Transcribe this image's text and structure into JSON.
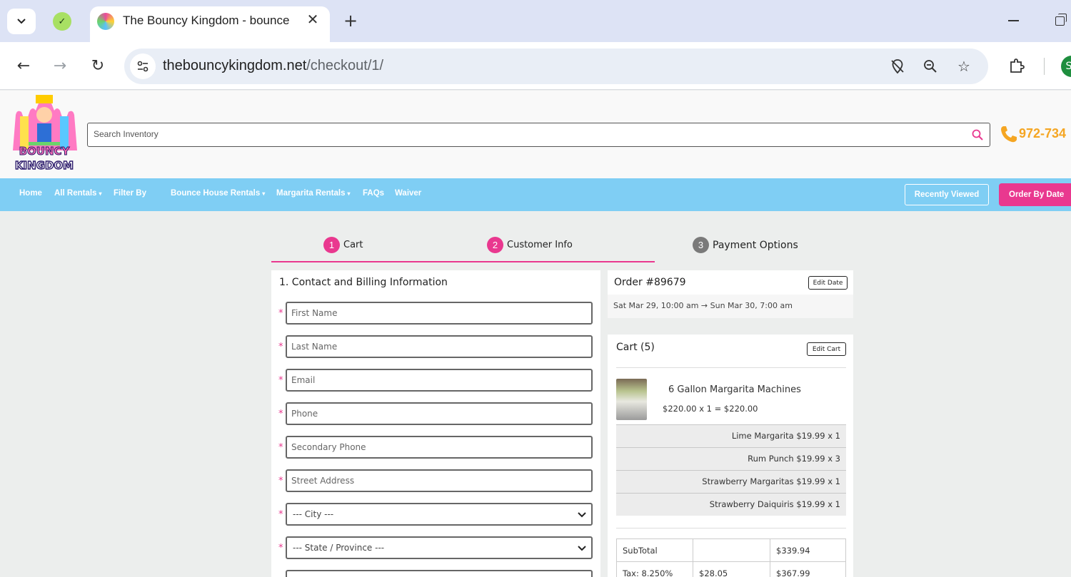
{
  "browser": {
    "tab_title": "The Bouncy Kingdom - bounce",
    "url_domain": "thebouncykingdom.net",
    "url_path": "/checkout/1/",
    "profile_initial": "S"
  },
  "header": {
    "search_placeholder": "Search Inventory",
    "phone": "972-734"
  },
  "nav": {
    "home": "Home",
    "all_rentals": "All Rentals",
    "filter_by": "Filter By",
    "bounce_house_rentals": "Bounce House Rentals",
    "margarita_rentals": "Margarita Rentals",
    "faqs": "FAQs",
    "waiver": "Waiver",
    "recently_viewed": "Recently Viewed",
    "order_by_date": "Order By Date"
  },
  "steps": [
    {
      "num": "1",
      "label": "Cart"
    },
    {
      "num": "2",
      "label": "Customer Info"
    },
    {
      "num": "3",
      "label": "Payment Options"
    }
  ],
  "form": {
    "section_title": "1. Contact and Billing Information",
    "required_mark": "*",
    "first_name": "First Name",
    "last_name": "Last Name",
    "email": "Email",
    "phone": "Phone",
    "secondary_phone": "Secondary Phone",
    "street_address": "Street Address",
    "city": "--- City ---",
    "state": "--- State / Province ---"
  },
  "order": {
    "number": "Order #89679",
    "edit_date": "Edit Date",
    "dates": "Sat Mar 29, 10:00 am → Sun Mar 30, 7:00 am"
  },
  "cart": {
    "title": "Cart (5)",
    "edit_cart": "Edit Cart",
    "product_name": "6 Gallon Margarita Machines",
    "product_price": "$220.00  x 1 =  $220.00",
    "addons": [
      "Lime Margarita  $19.99  x  1",
      "Rum Punch  $19.99  x  3",
      "Strawberry Margaritas  $19.99  x  1",
      "Strawberry Daiquiris  $19.99  x  1"
    ],
    "totals": [
      [
        "SubTotal",
        "",
        "$339.94"
      ],
      [
        "Tax: 8.250%",
        "$28.05",
        "$367.99"
      ]
    ]
  },
  "colors": {
    "accent_pink": "#e9388f",
    "nav_blue": "#7fcef4",
    "phone_orange": "#f5a623"
  }
}
